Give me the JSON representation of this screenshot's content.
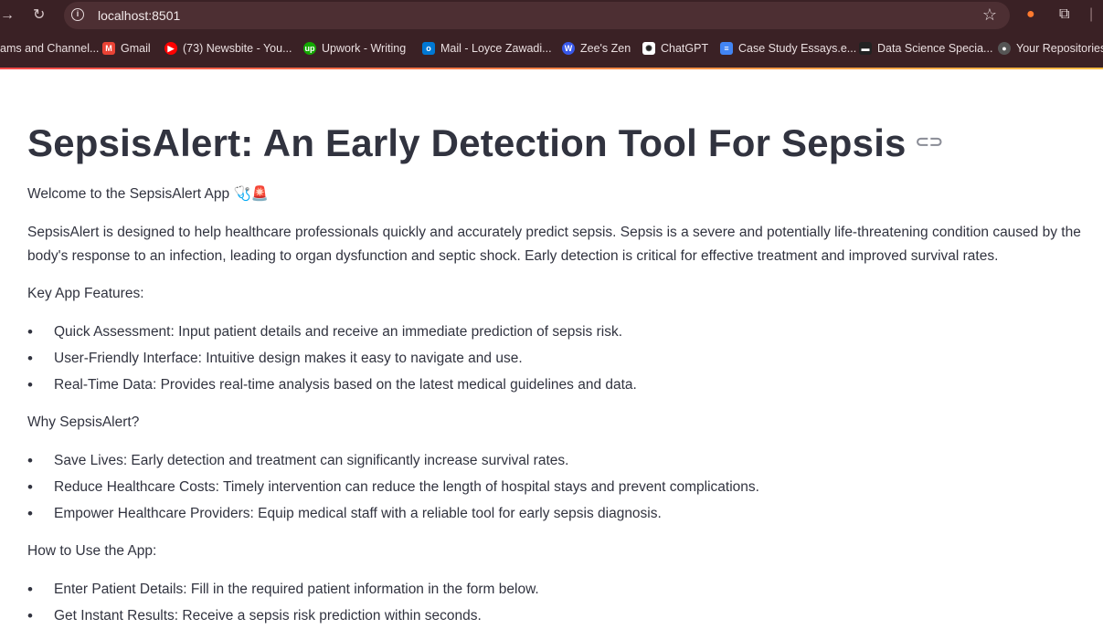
{
  "browser": {
    "url": "localhost:8501",
    "bookmarks": [
      {
        "label": "ams and Channel...",
        "icon": "none",
        "color": ""
      },
      {
        "label": "Gmail",
        "icon": "gmail-icon",
        "color": "#ea4335"
      },
      {
        "label": "(73) Newsbite - You...",
        "icon": "youtube-icon",
        "color": "#ff0000"
      },
      {
        "label": "Upwork - Writing",
        "icon": "upwork-icon",
        "color": "#14a800"
      },
      {
        "label": "Mail - Loyce Zawadi...",
        "icon": "outlook-icon",
        "color": "#0078d4"
      },
      {
        "label": "Zee's Zen",
        "icon": "wordpress-icon",
        "color": "#3858e9"
      },
      {
        "label": "ChatGPT",
        "icon": "chatgpt-icon",
        "color": "#ffffff"
      },
      {
        "label": "Case Study Essays.e...",
        "icon": "docs-icon",
        "color": "#4285f4"
      },
      {
        "label": "Data Science Specia...",
        "icon": "course-icon",
        "color": "#222222"
      },
      {
        "label": "Your Repositories",
        "icon": "github-icon",
        "color": "#555555"
      }
    ]
  },
  "page": {
    "title": "SepsisAlert: An Early Detection Tool For Sepsis",
    "welcome": "Welcome to the SepsisAlert App 🩺🚨",
    "intro": "SepsisAlert is designed to help healthcare professionals quickly and accurately predict sepsis. Sepsis is a severe and potentially life-threatening condition caused by the body's response to an infection, leading to organ dysfunction and septic shock. Early detection is critical for effective treatment and improved survival rates.",
    "features_heading": "Key App Features:",
    "features": [
      "Quick Assessment: Input patient details and receive an immediate prediction of sepsis risk.",
      "User-Friendly Interface: Intuitive design makes it easy to navigate and use.",
      "Real-Time Data: Provides real-time analysis based on the latest medical guidelines and data."
    ],
    "why_heading": "Why SepsisAlert?",
    "why": [
      "Save Lives: Early detection and treatment can significantly increase survival rates.",
      "Reduce Healthcare Costs: Timely intervention can reduce the length of hospital stays and prevent complications.",
      "Empower Healthcare Providers: Equip medical staff with a reliable tool for early sepsis diagnosis."
    ],
    "howto_heading": "How to Use the App:",
    "howto": [
      "Enter Patient Details: Fill in the required patient information in the form below.",
      "Get Instant Results: Receive a sepsis risk prediction within seconds."
    ]
  }
}
